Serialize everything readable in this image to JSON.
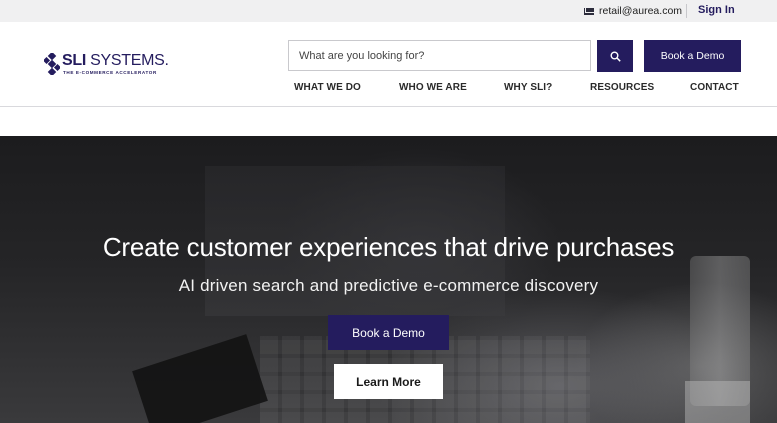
{
  "topbar": {
    "email": "retail@aurea.com",
    "signin_label": "Sign In",
    "mail_icon": "mail-icon"
  },
  "header": {
    "logo": {
      "brand_bold": "SLI",
      "brand_thin": " SYSTEMS.",
      "tagline": "THE E-COMMERCE ACCELERATOR",
      "icon": "sli-logo-icon"
    },
    "search": {
      "placeholder": "What are you looking for?",
      "value": "",
      "button_icon": "search-icon"
    },
    "book_demo_label": "Book a Demo",
    "nav": [
      {
        "label": "WHAT WE DO"
      },
      {
        "label": "WHO WE ARE"
      },
      {
        "label": "WHY SLI?"
      },
      {
        "label": "RESOURCES"
      },
      {
        "label": "CONTACT"
      }
    ]
  },
  "hero": {
    "headline": "Create customer experiences that drive purchases",
    "subheadline": "AI driven search and predictive e-commerce discovery",
    "primary_button": "Book a Demo",
    "secondary_button": "Learn More"
  },
  "colors": {
    "brand": "#241c5e",
    "topbar_bg": "#f0f0f1",
    "hero_text": "#ffffff"
  }
}
